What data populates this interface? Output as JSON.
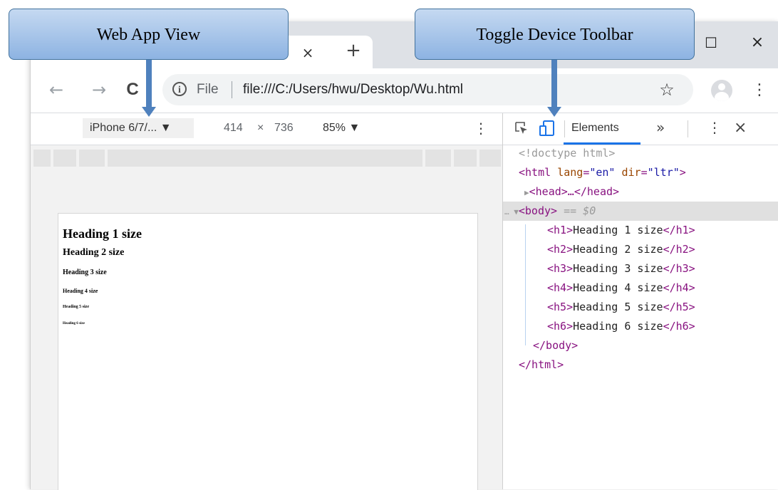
{
  "callouts": {
    "left": "Web App View",
    "right": "Toggle Device Toolbar"
  },
  "tabstrip": {
    "close_glyph": "×",
    "new_tab_glyph": "+",
    "maximize_glyph": "☐",
    "window_close_glyph": "×"
  },
  "toolbar": {
    "back_glyph": "←",
    "forward_glyph": "→",
    "reload_glyph": "C",
    "info_glyph": "i",
    "file_label": "File",
    "url": "file:///C:/Users/hwu/Desktop/Wu.html",
    "star_glyph": "☆",
    "menu_glyph": "⋮"
  },
  "device_toolbar": {
    "device": "iPhone 6/7/... ▼",
    "width": "414",
    "times": "×",
    "height": "736",
    "zoom": "85% ▼",
    "menu_glyph": "⋮"
  },
  "page": {
    "h1": "Heading 1 size",
    "h2": "Heading 2 size",
    "h3": "Heading 3 size",
    "h4": "Heading 4 size",
    "h5": "Heading 5 size",
    "h6": "Heading 6 size"
  },
  "devtools": {
    "tab_elements": "Elements",
    "more_glyph": "»",
    "menu_glyph": "⋮",
    "close_glyph": "×",
    "code": {
      "doctype": "<!doctype html>",
      "html_open_tag": "<html",
      "lang_attr": "lang",
      "lang_val": "\"en\"",
      "dir_attr": "dir",
      "dir_val": "\"ltr\"",
      "html_open_close": ">",
      "head_arrow": "▶",
      "head": "<head>…</head>",
      "body_prefix": "… ▼",
      "body_open": "<body>",
      "body_eq": " == $0",
      "h1_open": "<h1>",
      "h1_text": "Heading 1 size",
      "h1_close": "</h1>",
      "h2_open": "<h2>",
      "h2_text": "Heading 2 size",
      "h2_close": "</h2>",
      "h3_open": "<h3>",
      "h3_text": "Heading 3 size",
      "h3_close": "</h3>",
      "h4_open": "<h4>",
      "h4_text": "Heading 4 size",
      "h4_close": "</h4>",
      "h5_open": "<h5>",
      "h5_text": "Heading 5 size",
      "h5_close": "</h5>",
      "h6_open": "<h6>",
      "h6_text": "Heading 6 size",
      "h6_close": "</h6>",
      "body_close": "</body>",
      "html_close": "</html>"
    }
  },
  "colors": {
    "accent": "#1a73e8",
    "callout_border": "#41719c",
    "arrow": "#4f81bd"
  }
}
